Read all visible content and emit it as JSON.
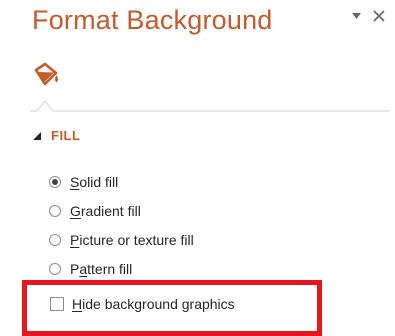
{
  "pane": {
    "title": "Format Background",
    "tab_icon": "paint-bucket-icon"
  },
  "colors": {
    "accent": "#c55a2b",
    "highlight": "#e8161e",
    "text": "#262626"
  },
  "section": {
    "label": "FILL",
    "expanded": true
  },
  "fill_options": [
    {
      "prefix": "",
      "access_key": "S",
      "rest": "olid fill",
      "selected": true
    },
    {
      "prefix": "",
      "access_key": "G",
      "rest": "radient fill",
      "selected": false
    },
    {
      "prefix": "",
      "access_key": "P",
      "rest": "icture or texture fill",
      "selected": false
    },
    {
      "prefix": "P",
      "access_key": "a",
      "rest": "ttern fill",
      "selected": false
    }
  ],
  "hide_graphics": {
    "prefix": "",
    "access_key": "H",
    "rest": "ide background graphics",
    "checked": false
  }
}
